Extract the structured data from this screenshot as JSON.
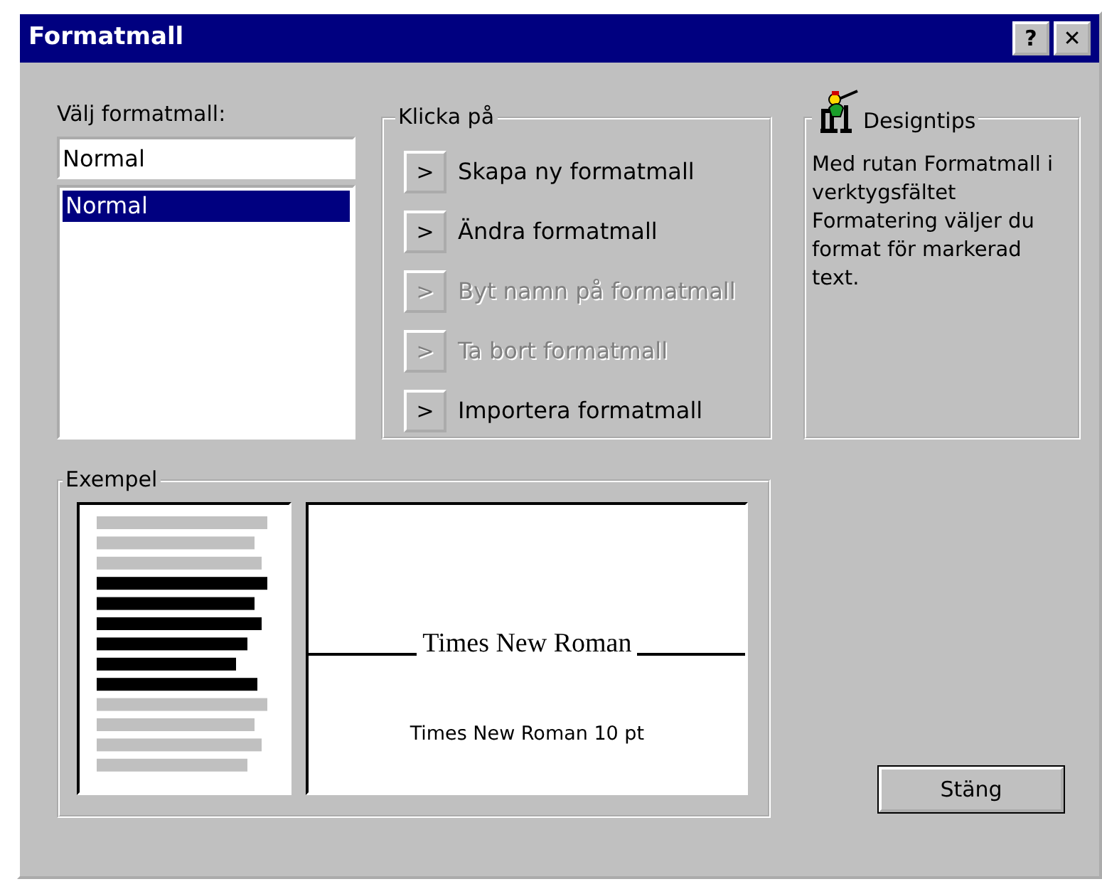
{
  "window": {
    "title": "Formatmall",
    "buttons": [
      "?",
      "✕"
    ]
  },
  "style_picker": {
    "label": "Välj formatmall:",
    "value": "Normal",
    "items": [
      {
        "label": "Normal",
        "selected": true
      }
    ]
  },
  "actions": {
    "title": "Klicka på",
    "buttons": [
      {
        "icon": ">",
        "label": "Skapa ny formatmall",
        "disabled": false
      },
      {
        "icon": ">",
        "label": "Ändra formatmall",
        "disabled": false
      },
      {
        "icon": ">",
        "label": "Byt namn på formatmall",
        "disabled": true
      },
      {
        "icon": ">",
        "label": "Ta bort formatmall",
        "disabled": true
      },
      {
        "icon": ">",
        "label": "Importera formatmall",
        "disabled": false
      }
    ]
  },
  "tips": {
    "title": "Designtips",
    "text": "Med rutan Formatmall i verktygsfältet Formatering väljer du format för markerad text."
  },
  "preview": {
    "title": "Exempel",
    "font_sample": "Times New Roman",
    "font_info": "Times New Roman 10 pt"
  },
  "close_button": "Stäng"
}
